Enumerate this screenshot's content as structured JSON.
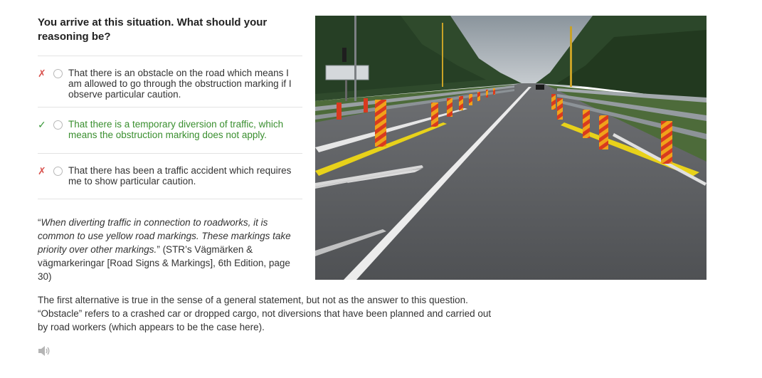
{
  "question": "You arrive at this situation. What should your reasoning be?",
  "answers": [
    {
      "mark": "✗",
      "text": "That there is an obstacle on the road which means I am allowed to go through the obstruction marking if I observe particular caution.",
      "status": "wrong"
    },
    {
      "mark": "✓",
      "text": "That there is a temporary diversion of traffic, which means the obstruction marking does not apply.",
      "status": "correct"
    },
    {
      "mark": "✗",
      "text": "That there has been a traffic accident which requires me to show particular caution.",
      "status": "wrong"
    }
  ],
  "explanation": {
    "quote_open": "“",
    "quote": "When diverting traffic in connection to roadworks, it is common to use yellow road markings. These markings take priority over other markings.",
    "quote_close": "”",
    "source": " (STR’s Vägmärken & vägmarkeringar [Road Signs & Markings], 6th Edition, page 30)",
    "body": "The first alternative is true in the sense of a general statement, but not as the answer to this question. “Obstacle” refers to a crashed car or dropped cargo, not diversions that have been planned and carried out by road workers (which appears to be the case here)."
  },
  "audio_icon": "speaker-icon",
  "colors": {
    "correct": "#3a8f2f",
    "wrong": "#d9534f",
    "road_marking_yellow": "#e8d21a",
    "post_red": "#d93a1f"
  }
}
